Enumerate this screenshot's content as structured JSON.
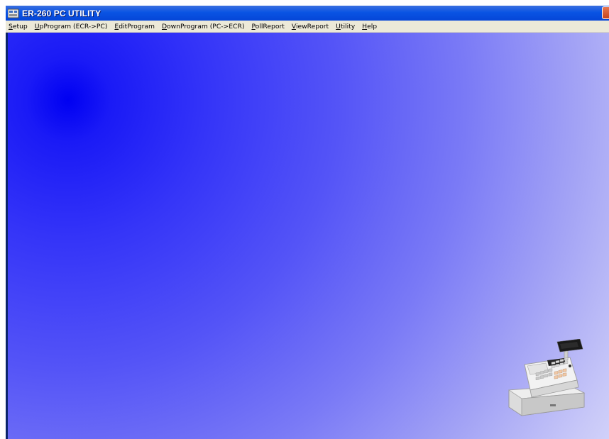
{
  "window": {
    "title": "ER-260 PC UTILITY"
  },
  "menu": [
    {
      "accel": "S",
      "rest": "etup"
    },
    {
      "accel": "U",
      "rest": "pProgram (ECR->PC)"
    },
    {
      "accel": "E",
      "rest": "ditProgram"
    },
    {
      "accel": "D",
      "rest": "ownProgram (PC->ECR)"
    },
    {
      "accel": "P",
      "rest": "ollReport"
    },
    {
      "accel": "V",
      "rest": "iewReport"
    },
    {
      "accel": "U",
      "rest": "tility"
    },
    {
      "accel": "H",
      "rest": "elp"
    }
  ],
  "colors": {
    "titlebar": "#0a54e3",
    "menubar": "#ece9d8",
    "background_center": "#0000f2",
    "background_edge": "#dedefb"
  },
  "icons": {
    "app": "app-icon",
    "close": "close-icon",
    "illustration": "cash-register-icon"
  }
}
